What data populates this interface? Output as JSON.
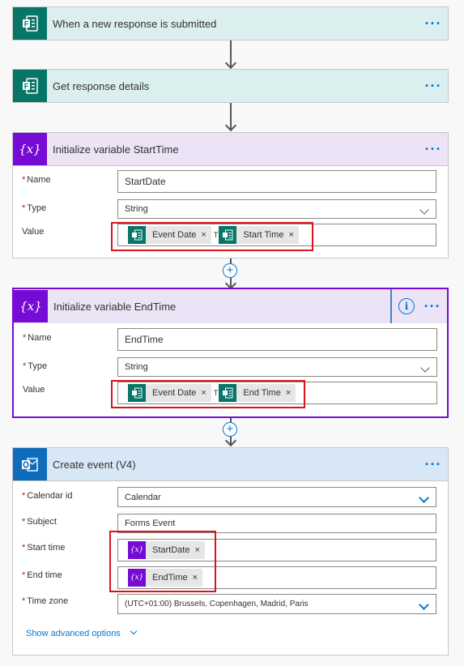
{
  "trigger": {
    "title": "When a new response is submitted",
    "menu": "···"
  },
  "get_details": {
    "title": "Get response details",
    "menu": "···"
  },
  "init_start": {
    "title": "Initialize variable StartTime",
    "menu": "···",
    "name_label": "Name",
    "name_value": "StartDate",
    "type_label": "Type",
    "type_value": "String",
    "value_label": "Value",
    "tokens": [
      "Event Date",
      "Start Time"
    ],
    "separator": "T"
  },
  "init_end": {
    "title": "Initialize variable EndTime",
    "menu": "···",
    "info": "i",
    "name_label": "Name",
    "name_value": "EndTime",
    "type_label": "Type",
    "type_value": "String",
    "value_label": "Value",
    "tokens": [
      "Event Date",
      "End Time"
    ],
    "separator": "T"
  },
  "create_event": {
    "title": "Create event (V4)",
    "menu": "···",
    "calendar_label": "Calendar id",
    "calendar_value": "Calendar",
    "subject_label": "Subject",
    "subject_value": "Forms Event",
    "start_label": "Start time",
    "start_token": "StartDate",
    "end_label": "End time",
    "end_token": "EndTime",
    "tz_label": "Time zone",
    "tz_value": "(UTC+01:00) Brussels, Copenhagen, Madrid, Paris",
    "advanced": "Show advanced options"
  },
  "plus": "+",
  "required_mark": "*",
  "token_close": "×",
  "icons": {
    "forms": "forms-icon",
    "variable": "variable-icon",
    "outlook": "outlook-icon"
  },
  "colors": {
    "forms": "#077568",
    "variable": "#770bd6",
    "outlook": "#0f6cbd",
    "accent": "#0078d4",
    "highlight": "#d9141d"
  }
}
